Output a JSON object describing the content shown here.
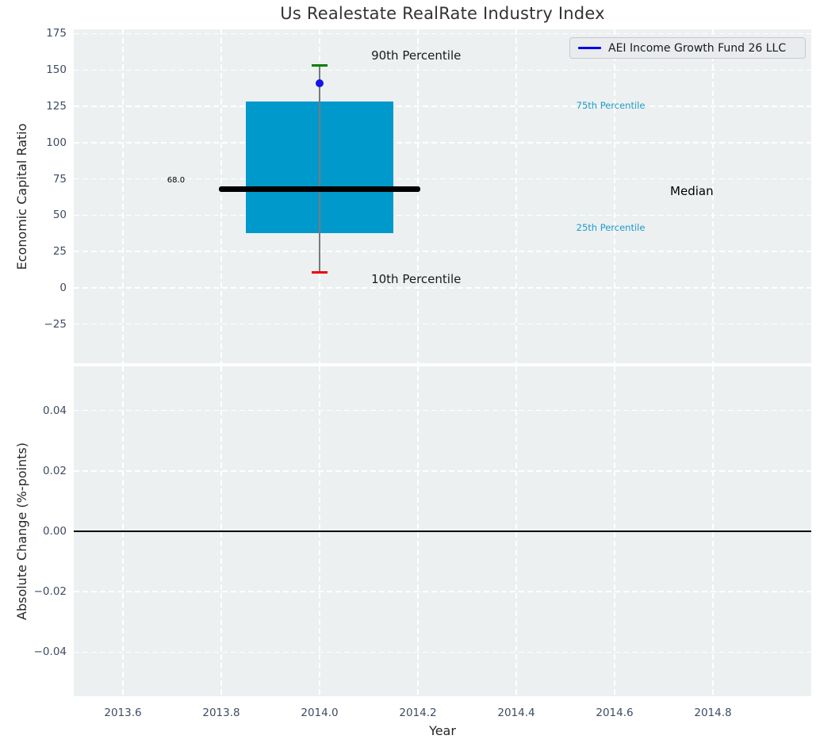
{
  "title": "Us Realestate RealRate Industry Index",
  "legend": {
    "label": "AEI Income Growth Fund 26 LLC",
    "line_color": "#0000ee"
  },
  "colors": {
    "plot_bg": "#ecf0f1",
    "grid": "#ffffff",
    "box_fill": "#0099cc",
    "median_line": "#000000",
    "whisker": "#7a7a7a",
    "cap_90th": "#008000",
    "cap_10th": "#ee0000",
    "fund_point": "#1515e8",
    "percentile_text": "#1e9bc7",
    "tick_text": "#3d4c63",
    "zero_line": "#000000"
  },
  "chart_data": [
    {
      "type": "box",
      "ylabel": "Economic Capital Ratio",
      "ylim": [
        -52,
        178
      ],
      "xlim": [
        2013.5,
        2015.0
      ],
      "grid": true,
      "legend_position": "upper right",
      "series_label": "AEI Income Growth Fund 26 LLC",
      "yticks": [
        {
          "v": 175,
          "label": "175"
        },
        {
          "v": 150,
          "label": "150"
        },
        {
          "v": 125,
          "label": "125"
        },
        {
          "v": 100,
          "label": "100"
        },
        {
          "v": 75,
          "label": "75"
        },
        {
          "v": 50,
          "label": "50"
        },
        {
          "v": 25,
          "label": "25"
        },
        {
          "v": 0,
          "label": "0"
        },
        {
          "v": -25,
          "label": "−25"
        }
      ],
      "xticks": [
        {
          "v": 2013.6,
          "label": "2013.6"
        },
        {
          "v": 2013.8,
          "label": "2013.8"
        },
        {
          "v": 2014.0,
          "label": "2014.0"
        },
        {
          "v": 2014.2,
          "label": "2014.2"
        },
        {
          "v": 2014.4,
          "label": "2014.4"
        },
        {
          "v": 2014.6,
          "label": "2014.6"
        },
        {
          "v": 2014.8,
          "label": "2014.8"
        }
      ],
      "box": {
        "x": 2014.0,
        "p10": 10.5,
        "q1": 37.5,
        "median": 68.0,
        "q3": 128.5,
        "p90": 153,
        "fund_value": 141,
        "box_width": 0.3,
        "median_width": 0.41,
        "cap_width": 0.032,
        "median_label": "68.0"
      },
      "annotations": [
        {
          "text": "90th Percentile",
          "x": 2014.105,
          "y": 159,
          "size": 15,
          "color": "#1a1a1a"
        },
        {
          "text": "10th Percentile",
          "x": 2014.105,
          "y": 5,
          "size": 15,
          "color": "#1a1a1a"
        },
        {
          "text": "Median",
          "x": 2014.713,
          "y": 66,
          "size": 15,
          "color": "#000000"
        },
        {
          "text": "75th Percentile",
          "x": 2014.522,
          "y": 125,
          "size": 11.5,
          "color": "#1e9bc7"
        },
        {
          "text": "25th Percentile",
          "x": 2014.522,
          "y": 41,
          "size": 11.5,
          "color": "#1e9bc7"
        },
        {
          "text": "68.0",
          "x": 2013.69,
          "y": 73,
          "size": 10,
          "color": "#000000"
        }
      ]
    },
    {
      "type": "line",
      "ylabel": "Absolute Change (%-points)",
      "xlabel": "Year",
      "ylim": [
        -0.0546,
        0.0546
      ],
      "xlim": [
        2013.5,
        2015.0
      ],
      "grid": true,
      "zero_line_y": 0.0,
      "yticks": [
        {
          "v": 0.04,
          "label": "0.04"
        },
        {
          "v": 0.02,
          "label": "0.02"
        },
        {
          "v": 0.0,
          "label": "0.00"
        },
        {
          "v": -0.02,
          "label": "−0.02"
        },
        {
          "v": -0.04,
          "label": "−0.04"
        }
      ]
    }
  ]
}
